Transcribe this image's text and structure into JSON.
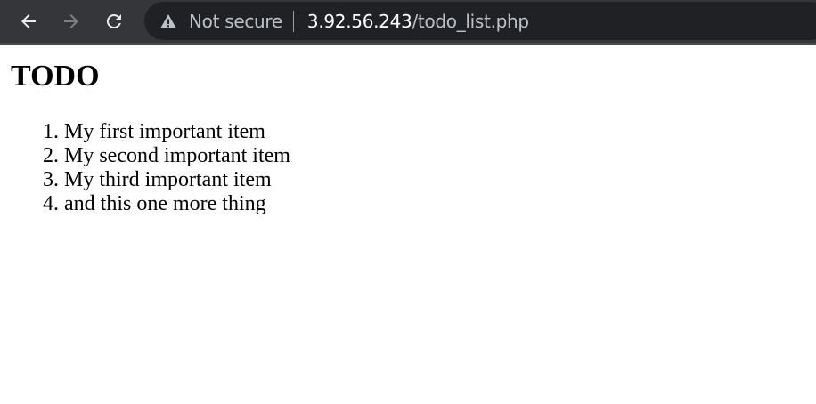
{
  "browser": {
    "icons": {
      "back": "arrow-left-icon",
      "forward": "arrow-right-icon",
      "reload": "reload-icon",
      "security": "warning-triangle-icon"
    },
    "security_label": "Not secure",
    "url_host": "3.92.56.243",
    "url_path": "/todo_list.php"
  },
  "page": {
    "title": "TODO",
    "items": [
      "My first important item",
      "My second important item",
      "My third important item",
      "and this one more thing"
    ]
  },
  "colors": {
    "toolbar": "#35363a",
    "omnibox": "#202124",
    "omnibox_text": "#bdc1c6",
    "host_text": "#ffffff",
    "page_background": "#ffffff",
    "page_text": "#000000"
  }
}
